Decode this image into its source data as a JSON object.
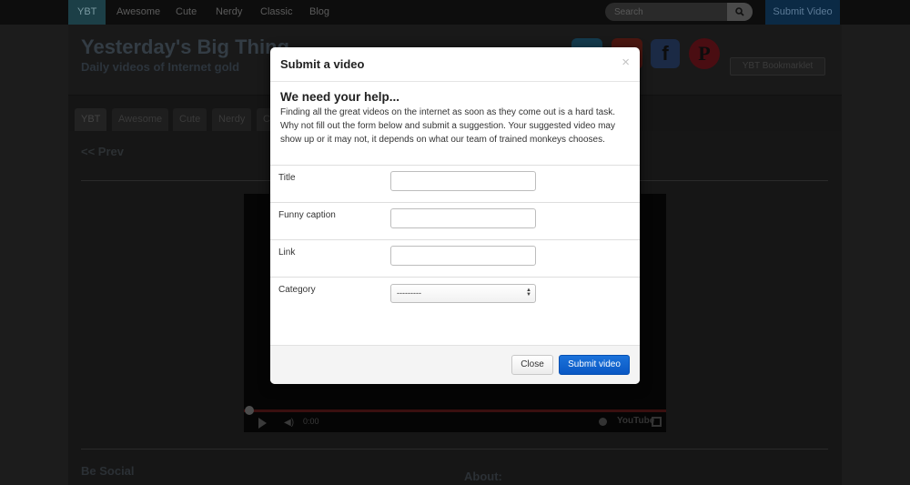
{
  "navbar": {
    "items": [
      "YBT",
      "Awesome",
      "Cute",
      "Nerdy",
      "Classic",
      "Blog"
    ],
    "search_placeholder": "Search",
    "submit_label": "Submit Video"
  },
  "header": {
    "title": "Yesterday's Big Thing",
    "tagline": "Daily videos of Internet gold",
    "social_icons": [
      "twitter-icon",
      "google-plus-icon",
      "facebook-icon",
      "pinterest-icon"
    ],
    "bookmarklet_label": "YBT Bookmarklet"
  },
  "subtabs": [
    "YBT",
    "Awesome",
    "Cute",
    "Nerdy",
    "C"
  ],
  "content": {
    "prev_label": "<< Prev",
    "video_time": "0:00",
    "video_brand": "YouTube",
    "be_social_heading": "Be Social",
    "about_heading": "About:"
  },
  "modal": {
    "title": "Submit a video",
    "close_symbol": "×",
    "help_title": "We need your help...",
    "help_text": "Finding all the great videos on the internet as soon as they come out is a hard task. Why not fill out the form below and submit a suggestion. Your suggested video may show up or it may not, it depends on what our team of trained monkeys chooses.",
    "fields": {
      "title_label": "Title",
      "caption_label": "Funny caption",
      "link_label": "Link",
      "category_label": "Category",
      "category_value": "---------"
    },
    "close_button": "Close",
    "submit_button": "Submit video"
  },
  "colors": {
    "primary_button": "#0a58c4",
    "navbar_active": "#1c3f47",
    "navbar_submit": "#0b2a45"
  }
}
